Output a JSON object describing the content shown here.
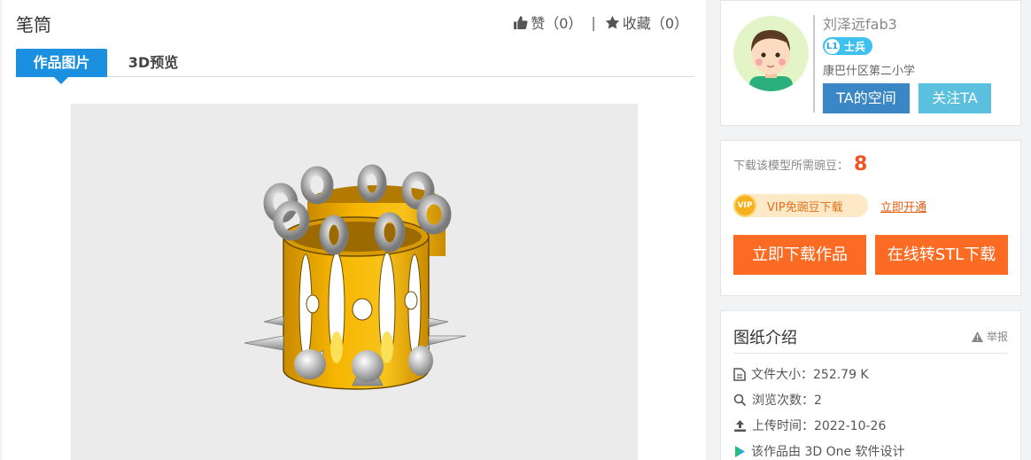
{
  "work": {
    "title": "笔筒"
  },
  "actions": {
    "like_label": "赞",
    "like_count": "（0）",
    "separator": "|",
    "favorite_label": "收藏",
    "favorite_count": "（0）"
  },
  "tabs": [
    {
      "label": "作品图片",
      "active": true
    },
    {
      "label": "3D预览",
      "active": false
    }
  ],
  "author": {
    "name": "刘泽远fab3",
    "rank_level": "L1",
    "rank_title": "士兵",
    "school": "康巴什区第二小学",
    "space_button": "TA的空间",
    "follow_button": "关注TA"
  },
  "download": {
    "beans_label": "下载该模型所需豌豆：",
    "beans_value": "8",
    "vip_badge": "VIP",
    "vip_text": "VIP免豌豆下载",
    "vip_link": "立即开通",
    "download_button": "立即下载作品",
    "stl_button": "在线转STL下载"
  },
  "intro": {
    "title": "图纸介绍",
    "report": "举报",
    "file_size": "文件大小：252.79 K",
    "views": "浏览次数：2",
    "upload_time": "上传时间：2022-10-26",
    "software": "该作品由 3D One 软件设计"
  },
  "colors": {
    "accent_blue": "#1b8fe0",
    "download_orange": "#fb6b23",
    "beans_red": "#ee5520",
    "space_blue": "#3b86c4",
    "follow_cyan": "#5bc0de"
  }
}
